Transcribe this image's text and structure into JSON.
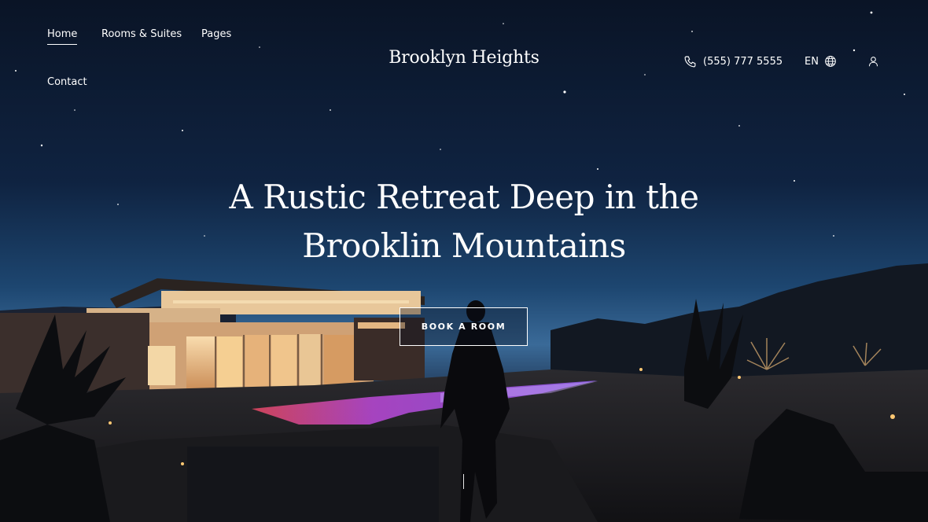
{
  "nav": {
    "links": [
      {
        "label": "Home",
        "active": true
      },
      {
        "label": "Rooms & Suites",
        "active": false
      },
      {
        "label": "Pages",
        "active": false
      },
      {
        "label": "Contact",
        "active": false
      }
    ]
  },
  "brand": {
    "name": "Brooklyn Heights"
  },
  "utility": {
    "phone": {
      "icon": "phone-icon",
      "number": "(555) 777 5555"
    },
    "language": {
      "code": "EN",
      "icon": "globe-icon"
    },
    "account": {
      "icon": "user-icon"
    }
  },
  "hero": {
    "headline_line1": "A Rustic Retreat Deep in the",
    "headline_line2": "Brooklin Mountains",
    "cta_label": "BOOK A ROOM"
  },
  "colors": {
    "sky_top": "#0b1426",
    "sky_horizon": "#2d5a8a",
    "warm_light": "#f2c98a",
    "pool_glow": "#c04bd8",
    "text": "#ffffff"
  }
}
